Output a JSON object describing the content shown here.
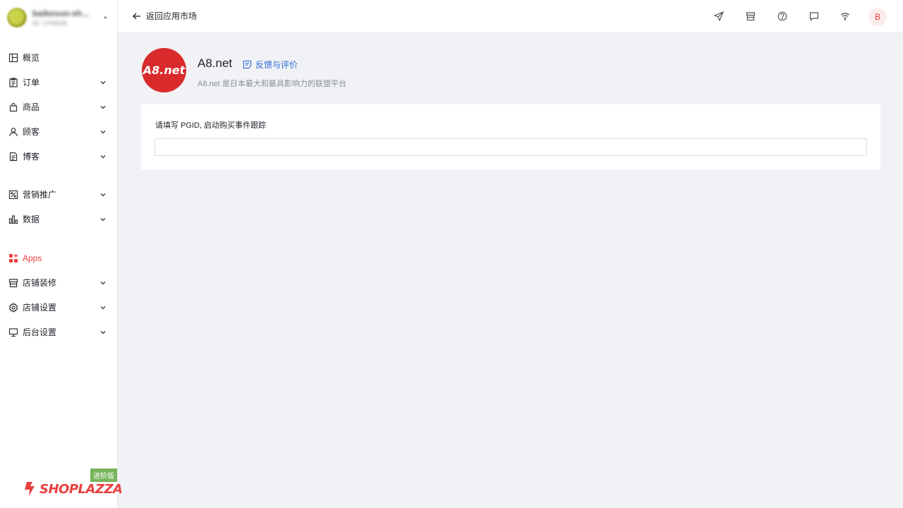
{
  "store": {
    "name": "baikesun-sh...",
    "id": "ID: 1700049"
  },
  "sidebar": {
    "items": [
      {
        "label": "概览",
        "icon": "dashboard-icon",
        "chevron": false
      },
      {
        "label": "订单",
        "icon": "clipboard-icon",
        "chevron": true
      },
      {
        "label": "商品",
        "icon": "shopping-bag-icon",
        "chevron": true
      },
      {
        "label": "顾客",
        "icon": "user-icon",
        "chevron": true
      },
      {
        "label": "博客",
        "icon": "document-icon",
        "chevron": true
      },
      {
        "label": "营销推广",
        "icon": "discount-icon",
        "chevron": true
      },
      {
        "label": "数据",
        "icon": "bar-chart-icon",
        "chevron": true
      },
      {
        "label": "Apps",
        "icon": "apps-icon",
        "chevron": false,
        "active": true
      },
      {
        "label": "店铺装修",
        "icon": "storefront-icon",
        "chevron": true
      },
      {
        "label": "店铺设置",
        "icon": "gear-icon",
        "chevron": true
      },
      {
        "label": "后台设置",
        "icon": "monitor-icon",
        "chevron": true
      }
    ]
  },
  "brand": {
    "badge": "进阶版",
    "logo": "SHOPLAZZA"
  },
  "topbar": {
    "back_label": "返回应用市场",
    "icons": [
      "send-icon",
      "store-icon",
      "help-icon",
      "message-icon",
      "wifi-icon"
    ],
    "user_initial": "B"
  },
  "app": {
    "logo_text": "A8.net",
    "name": "A8.net",
    "feedback_label": "反馈与评价",
    "description": "A8.net 是日本最大和最具影响力的联盟平台"
  },
  "form": {
    "label": "请填写 PGID, 启动购买事件跟踪",
    "value": "",
    "placeholder": ""
  },
  "colors": {
    "accent": "#e8413f",
    "link": "#2f6ed8",
    "badge": "#76b45a",
    "app_logo_bg": "#d92b2b"
  }
}
